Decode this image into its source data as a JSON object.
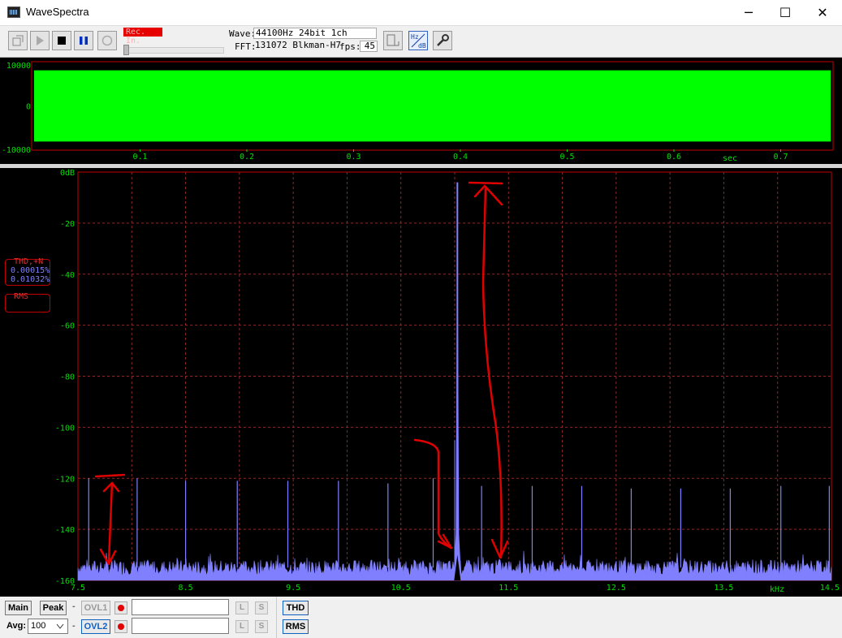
{
  "window": {
    "title": "WaveSpectra",
    "minimize_glyph": "─",
    "maximize_glyph": "☐",
    "close_glyph": "✕"
  },
  "toolbar": {
    "buttons": [
      {
        "name": "open-file-button",
        "icon": "open-file-icon"
      },
      {
        "name": "play-button",
        "icon": "play-icon"
      },
      {
        "name": "stop-button",
        "icon": "stop-icon"
      },
      {
        "name": "pause-button",
        "icon": "pause-icon"
      },
      {
        "name": "record-button",
        "icon": "record-icon"
      }
    ],
    "rec_label": "Rec. In.",
    "wave_label": "Wave:",
    "wave_value": "44100Hz 24bit 1ch",
    "fft_label": "FFT:",
    "fft_value": "131072 Blkman-H7",
    "fps_label": "fps:",
    "fps_value": "45",
    "right_buttons": [
      {
        "name": "layout-button",
        "icon": "window-layout-icon"
      },
      {
        "name": "hz-db-button",
        "icon": "hz-db-icon",
        "text_top": "Hz",
        "text_bottom": "dB"
      },
      {
        "name": "settings-button",
        "icon": "wrench-icon"
      }
    ],
    "colors": {
      "rec_bg": "#e60000",
      "pause_blue": "#0030c0"
    }
  },
  "waveform": {
    "y_ticks": [
      "10000",
      "0",
      "-10000"
    ],
    "x_ticks": [
      "0.1",
      "0.2",
      "0.3",
      "0.4",
      "0.5",
      "0.6",
      "0.7"
    ],
    "x_unit": "sec",
    "fill_color": "#00ff00",
    "frame_color": "#c00000",
    "label_color": "#00e000",
    "fill_level_fraction": 0.82
  },
  "side_panel": {
    "thd_label": "THD,+N",
    "thd_value": "0.00015%",
    "thdn_value": "0.01032%",
    "rms_label": "RMS"
  },
  "chart_data": {
    "type": "line",
    "title": "",
    "xlabel": "kHz",
    "ylabel": "",
    "xlim": [
      7.5,
      14.5
    ],
    "ylim": [
      -160,
      0
    ],
    "x_ticks": [
      "7.5",
      "8.5",
      "9.5",
      "10.5",
      "11.5",
      "12.5",
      "13.5",
      "14.5"
    ],
    "y_ticks": [
      "0dB",
      "-20",
      "-40",
      "-60",
      "-80",
      "-100",
      "-120",
      "-140",
      "-160"
    ],
    "grid": true,
    "noise_floor_db": -155,
    "main_peak": {
      "freq_khz": 11.025,
      "db": -4
    },
    "secondary_peaks_db": [
      {
        "freq_khz": 11.0,
        "db": -105
      }
    ],
    "spurs": [
      {
        "freq_khz": 7.6,
        "db": -120
      },
      {
        "freq_khz": 8.05,
        "db": -120
      },
      {
        "freq_khz": 8.5,
        "db": -121
      },
      {
        "freq_khz": 8.98,
        "db": -121
      },
      {
        "freq_khz": 9.45,
        "db": -121
      },
      {
        "freq_khz": 9.92,
        "db": -121
      },
      {
        "freq_khz": 10.38,
        "db": -122
      },
      {
        "freq_khz": 10.8,
        "db": -120
      },
      {
        "freq_khz": 11.25,
        "db": -123
      },
      {
        "freq_khz": 11.72,
        "db": -123
      },
      {
        "freq_khz": 12.18,
        "db": -123
      },
      {
        "freq_khz": 12.64,
        "db": -124
      },
      {
        "freq_khz": 13.1,
        "db": -124
      },
      {
        "freq_khz": 13.56,
        "db": -124
      },
      {
        "freq_khz": 14.03,
        "db": -123
      },
      {
        "freq_khz": 14.48,
        "db": -123
      }
    ],
    "colors": {
      "trace": "#8080ff",
      "grid": "#8a2a2a",
      "frame": "#c00000",
      "axis_labels": "#00e000",
      "annotation": "#e00000"
    }
  },
  "bottom": {
    "main_label": "Main",
    "peak_label": "Peak",
    "dash": "-",
    "ovl1_label": "OVL1",
    "ovl2_label": "OVL2",
    "avg_label": "Avg:",
    "avg_value": "100",
    "l_label": "L",
    "s_label": "S",
    "thd_button": "THD",
    "rms_button": "RMS"
  }
}
